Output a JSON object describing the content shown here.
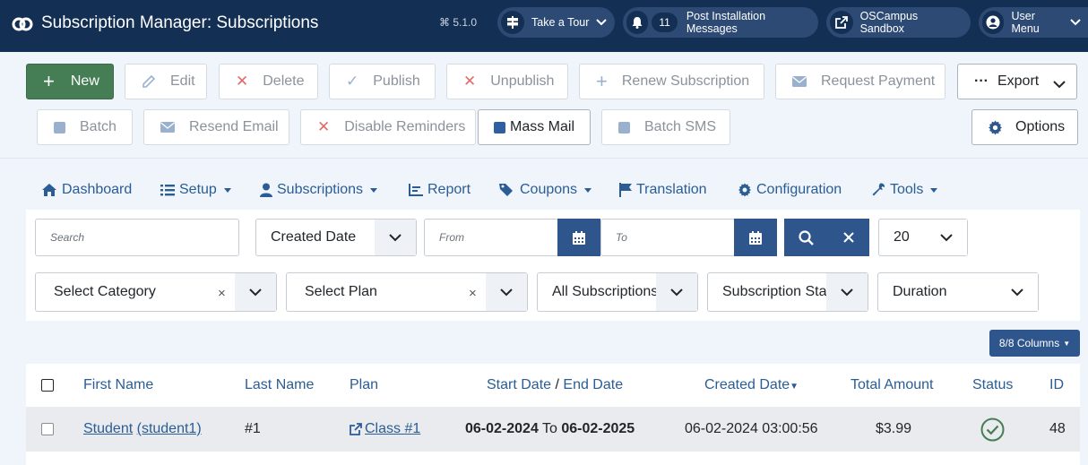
{
  "header": {
    "title": "Subscription Manager: Subscriptions",
    "version": "5.1.0",
    "take_tour": "Take a Tour",
    "notifications_count": "11",
    "post_install": "Post Installation Messages",
    "site_name": "OSCampus Sandbox",
    "user_menu": "User Menu"
  },
  "toolbar": {
    "new": "New",
    "edit": "Edit",
    "delete": "Delete",
    "publish": "Publish",
    "unpublish": "Unpublish",
    "renew": "Renew Subscription",
    "request_payment": "Request Payment",
    "export": "Export",
    "batch": "Batch",
    "resend_email": "Resend Email",
    "disable_reminders": "Disable Reminders",
    "mass_mail": "Mass Mail",
    "batch_sms": "Batch SMS",
    "options": "Options"
  },
  "nav": {
    "dashboard": "Dashboard",
    "setup": "Setup",
    "subscriptions": "Subscriptions",
    "report": "Report",
    "coupons": "Coupons",
    "translation": "Translation",
    "configuration": "Configuration",
    "tools": "Tools"
  },
  "filters": {
    "search_placeholder": "Search",
    "date_field": "Created Date",
    "from_placeholder": "From",
    "to_placeholder": "To",
    "limit": "20",
    "category": "Select Category",
    "plan": "Select Plan",
    "subscriptions": "All Subscriptions",
    "status": "Subscription Status",
    "duration": "Duration"
  },
  "columns_button": "8/8 Columns",
  "table": {
    "headers": {
      "first_name": "First Name",
      "last_name": "Last Name",
      "plan": "Plan",
      "start_date": "Start Date",
      "sep": "/",
      "end_date": "End Date",
      "created_date": "Created Date",
      "total_amount": "Total Amount",
      "status": "Status",
      "id": "ID"
    },
    "rows": [
      {
        "first_name": "Student",
        "username": "(student1)",
        "last_name": "#1",
        "plan": "Class #1",
        "start_date": "06-02-2024",
        "to": "To",
        "end_date": "06-02-2025",
        "created_date": "06-02-2024 03:00:56",
        "total_amount": "$3.99",
        "id": "48"
      }
    ]
  }
}
